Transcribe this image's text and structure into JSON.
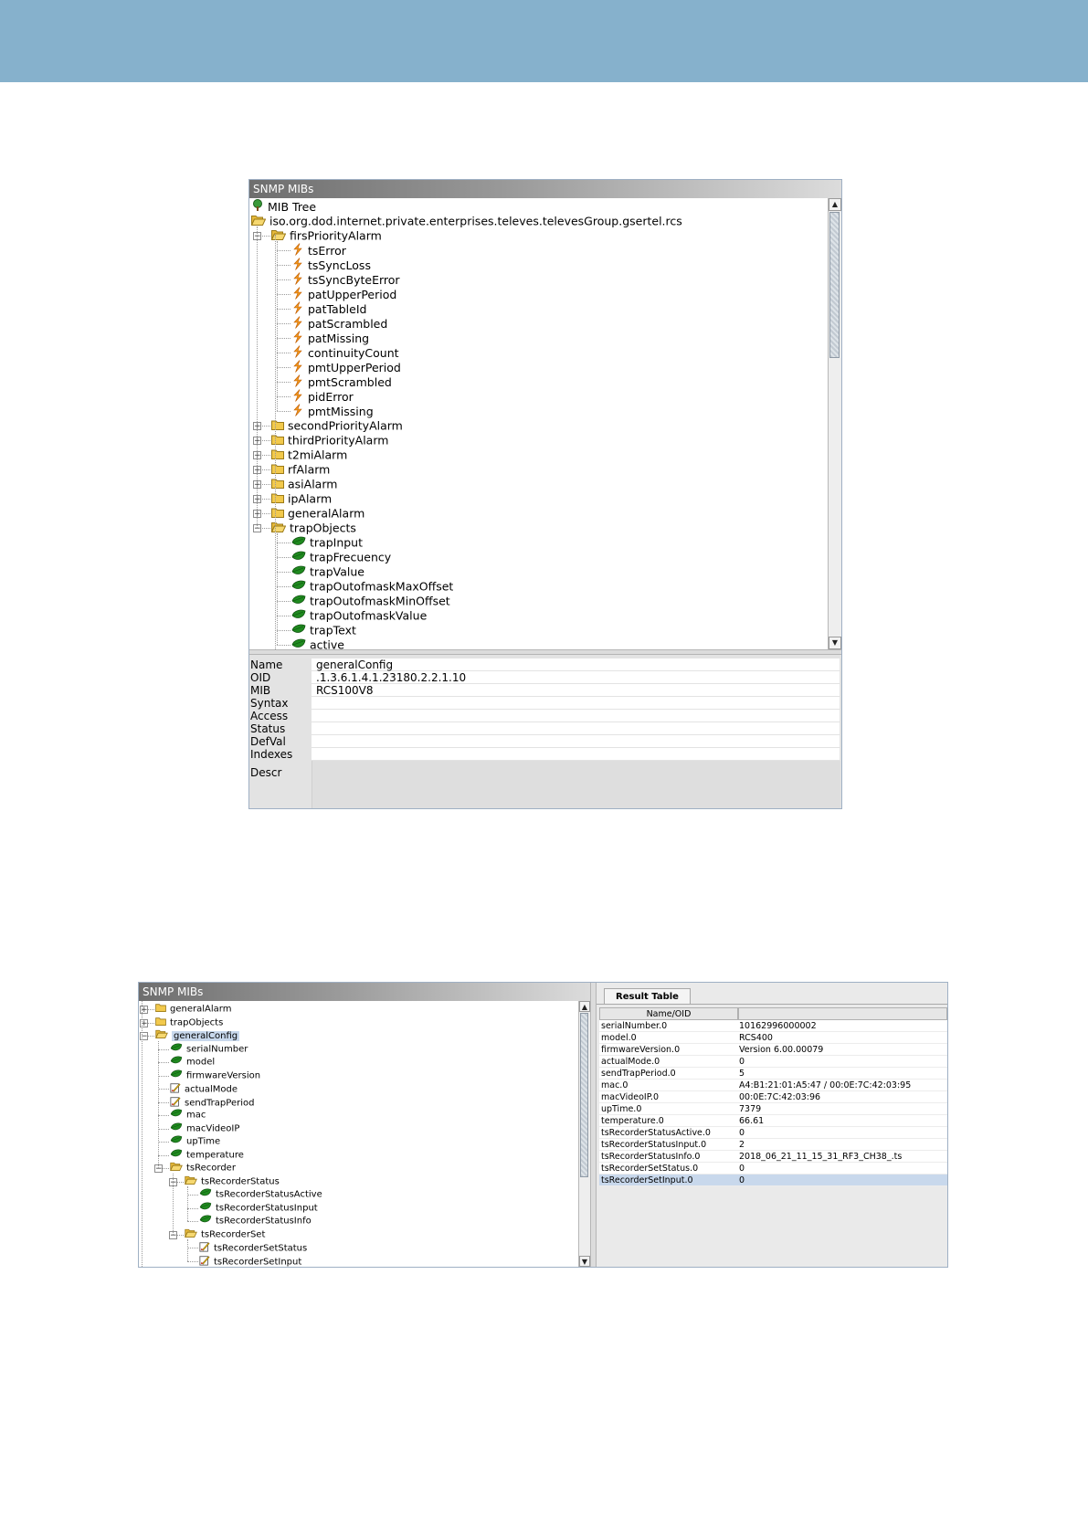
{
  "window1": {
    "title": "SNMP MIBs",
    "tree": [
      {
        "label": "MIB Tree",
        "icon": "tree-root-icon",
        "level": 0,
        "expander": ""
      },
      {
        "label": "iso.org.dod.internet.private.enterprises.televes.televesGroup.gsertel.rcs",
        "icon": "folder-open-icon",
        "level": 0,
        "expander": "minus"
      },
      {
        "label": "firsPriorityAlarm",
        "icon": "folder-open-icon",
        "level": 1,
        "expander": "minus"
      },
      {
        "label": "tsError",
        "icon": "trap-icon",
        "level": 2,
        "expander": ""
      },
      {
        "label": "tsSyncLoss",
        "icon": "trap-icon",
        "level": 2,
        "expander": ""
      },
      {
        "label": "tsSyncByteError",
        "icon": "trap-icon",
        "level": 2,
        "expander": ""
      },
      {
        "label": "patUpperPeriod",
        "icon": "trap-icon",
        "level": 2,
        "expander": ""
      },
      {
        "label": "patTableId",
        "icon": "trap-icon",
        "level": 2,
        "expander": ""
      },
      {
        "label": "patScrambled",
        "icon": "trap-icon",
        "level": 2,
        "expander": ""
      },
      {
        "label": "patMissing",
        "icon": "trap-icon",
        "level": 2,
        "expander": ""
      },
      {
        "label": "continuityCount",
        "icon": "trap-icon",
        "level": 2,
        "expander": ""
      },
      {
        "label": "pmtUpperPeriod",
        "icon": "trap-icon",
        "level": 2,
        "expander": ""
      },
      {
        "label": "pmtScrambled",
        "icon": "trap-icon",
        "level": 2,
        "expander": ""
      },
      {
        "label": "pidError",
        "icon": "trap-icon",
        "level": 2,
        "expander": ""
      },
      {
        "label": "pmtMissing",
        "icon": "trap-icon",
        "level": 2,
        "expander": ""
      },
      {
        "label": "secondPriorityAlarm",
        "icon": "folder-icon",
        "level": 1,
        "expander": "plus"
      },
      {
        "label": "thirdPriorityAlarm",
        "icon": "folder-icon",
        "level": 1,
        "expander": "plus"
      },
      {
        "label": "t2miAlarm",
        "icon": "folder-icon",
        "level": 1,
        "expander": "plus"
      },
      {
        "label": "rfAlarm",
        "icon": "folder-icon",
        "level": 1,
        "expander": "plus"
      },
      {
        "label": "asiAlarm",
        "icon": "folder-icon",
        "level": 1,
        "expander": "plus"
      },
      {
        "label": "ipAlarm",
        "icon": "folder-icon",
        "level": 1,
        "expander": "plus"
      },
      {
        "label": "generalAlarm",
        "icon": "folder-icon",
        "level": 1,
        "expander": "plus"
      },
      {
        "label": "trapObjects",
        "icon": "folder-open-icon",
        "level": 1,
        "expander": "minus"
      },
      {
        "label": "trapInput",
        "icon": "leaf-icon",
        "level": 2,
        "expander": ""
      },
      {
        "label": "trapFrecuency",
        "icon": "leaf-icon",
        "level": 2,
        "expander": ""
      },
      {
        "label": "trapValue",
        "icon": "leaf-icon",
        "level": 2,
        "expander": ""
      },
      {
        "label": "trapOutofmaskMaxOffset",
        "icon": "leaf-icon",
        "level": 2,
        "expander": ""
      },
      {
        "label": "trapOutofmaskMinOffset",
        "icon": "leaf-icon",
        "level": 2,
        "expander": ""
      },
      {
        "label": "trapOutofmaskValue",
        "icon": "leaf-icon",
        "level": 2,
        "expander": ""
      },
      {
        "label": "trapText",
        "icon": "leaf-icon",
        "level": 2,
        "expander": ""
      },
      {
        "label": "active",
        "icon": "leaf-icon",
        "level": 2,
        "expander": ""
      }
    ],
    "props": [
      {
        "label": "Name",
        "value": "generalConfig"
      },
      {
        "label": "OID",
        "value": ".1.3.6.1.4.1.23180.2.2.1.10"
      },
      {
        "label": "MIB",
        "value": "RCS100V8"
      },
      {
        "label": "Syntax",
        "value": ""
      },
      {
        "label": "Access",
        "value": ""
      },
      {
        "label": "Status",
        "value": ""
      },
      {
        "label": "DefVal",
        "value": ""
      },
      {
        "label": "Indexes",
        "value": ""
      }
    ],
    "descr_label": "Descr"
  },
  "window2": {
    "title": "SNMP MIBs",
    "tree": [
      {
        "label": "generalAlarm",
        "icon": "folder-icon",
        "level": 1,
        "expander": "plus"
      },
      {
        "label": "trapObjects",
        "icon": "folder-icon",
        "level": 1,
        "expander": "plus"
      },
      {
        "label": "generalConfig",
        "icon": "folder-open-icon",
        "level": 1,
        "expander": "minus",
        "selected": true
      },
      {
        "label": "serialNumber",
        "icon": "leaf-icon",
        "level": 2,
        "expander": ""
      },
      {
        "label": "model",
        "icon": "leaf-icon",
        "level": 2,
        "expander": ""
      },
      {
        "label": "firmwareVersion",
        "icon": "leaf-icon",
        "level": 2,
        "expander": ""
      },
      {
        "label": "actualMode",
        "icon": "edit-icon",
        "level": 2,
        "expander": ""
      },
      {
        "label": "sendTrapPeriod",
        "icon": "edit-icon",
        "level": 2,
        "expander": ""
      },
      {
        "label": "mac",
        "icon": "leaf-icon",
        "level": 2,
        "expander": ""
      },
      {
        "label": "macVideoIP",
        "icon": "leaf-icon",
        "level": 2,
        "expander": ""
      },
      {
        "label": "upTime",
        "icon": "leaf-icon",
        "level": 2,
        "expander": ""
      },
      {
        "label": "temperature",
        "icon": "leaf-icon",
        "level": 2,
        "expander": ""
      },
      {
        "label": "tsRecorder",
        "icon": "folder-open-icon",
        "level": 2,
        "expander": "minus"
      },
      {
        "label": "tsRecorderStatus",
        "icon": "folder-open-icon",
        "level": 3,
        "expander": "minus"
      },
      {
        "label": "tsRecorderStatusActive",
        "icon": "leaf-icon",
        "level": 4,
        "expander": ""
      },
      {
        "label": "tsRecorderStatusInput",
        "icon": "leaf-icon",
        "level": 4,
        "expander": ""
      },
      {
        "label": "tsRecorderStatusInfo",
        "icon": "leaf-icon",
        "level": 4,
        "expander": ""
      },
      {
        "label": "tsRecorderSet",
        "icon": "folder-open-icon",
        "level": 3,
        "expander": "minus"
      },
      {
        "label": "tsRecorderSetStatus",
        "icon": "edit-icon",
        "level": 4,
        "expander": ""
      },
      {
        "label": "tsRecorderSetInput",
        "icon": "edit-icon",
        "level": 4,
        "expander": ""
      }
    ],
    "result_tab": "Result Table",
    "result_columns": [
      "Name/OID",
      ""
    ],
    "result_rows": [
      {
        "name": "serialNumber.0",
        "value": "10162996000002"
      },
      {
        "name": "model.0",
        "value": "RCS400"
      },
      {
        "name": "firmwareVersion.0",
        "value": "Version 6.00.00079"
      },
      {
        "name": "actualMode.0",
        "value": "0"
      },
      {
        "name": "sendTrapPeriod.0",
        "value": "5"
      },
      {
        "name": "mac.0",
        "value": "A4:B1:21:01:A5:47 / 00:0E:7C:42:03:95"
      },
      {
        "name": "macVideoIP.0",
        "value": "00:0E:7C:42:03:96"
      },
      {
        "name": "upTime.0",
        "value": "7379"
      },
      {
        "name": "temperature.0",
        "value": "66.61"
      },
      {
        "name": "tsRecorderStatusActive.0",
        "value": "0"
      },
      {
        "name": "tsRecorderStatusInput.0",
        "value": "2"
      },
      {
        "name": "tsRecorderStatusInfo.0",
        "value": "2018_06_21_11_15_31_RF3_CH38_.ts"
      },
      {
        "name": "tsRecorderSetStatus.0",
        "value": "0"
      },
      {
        "name": "tsRecorderSetInput.0",
        "value": "0",
        "selected": true
      }
    ]
  }
}
